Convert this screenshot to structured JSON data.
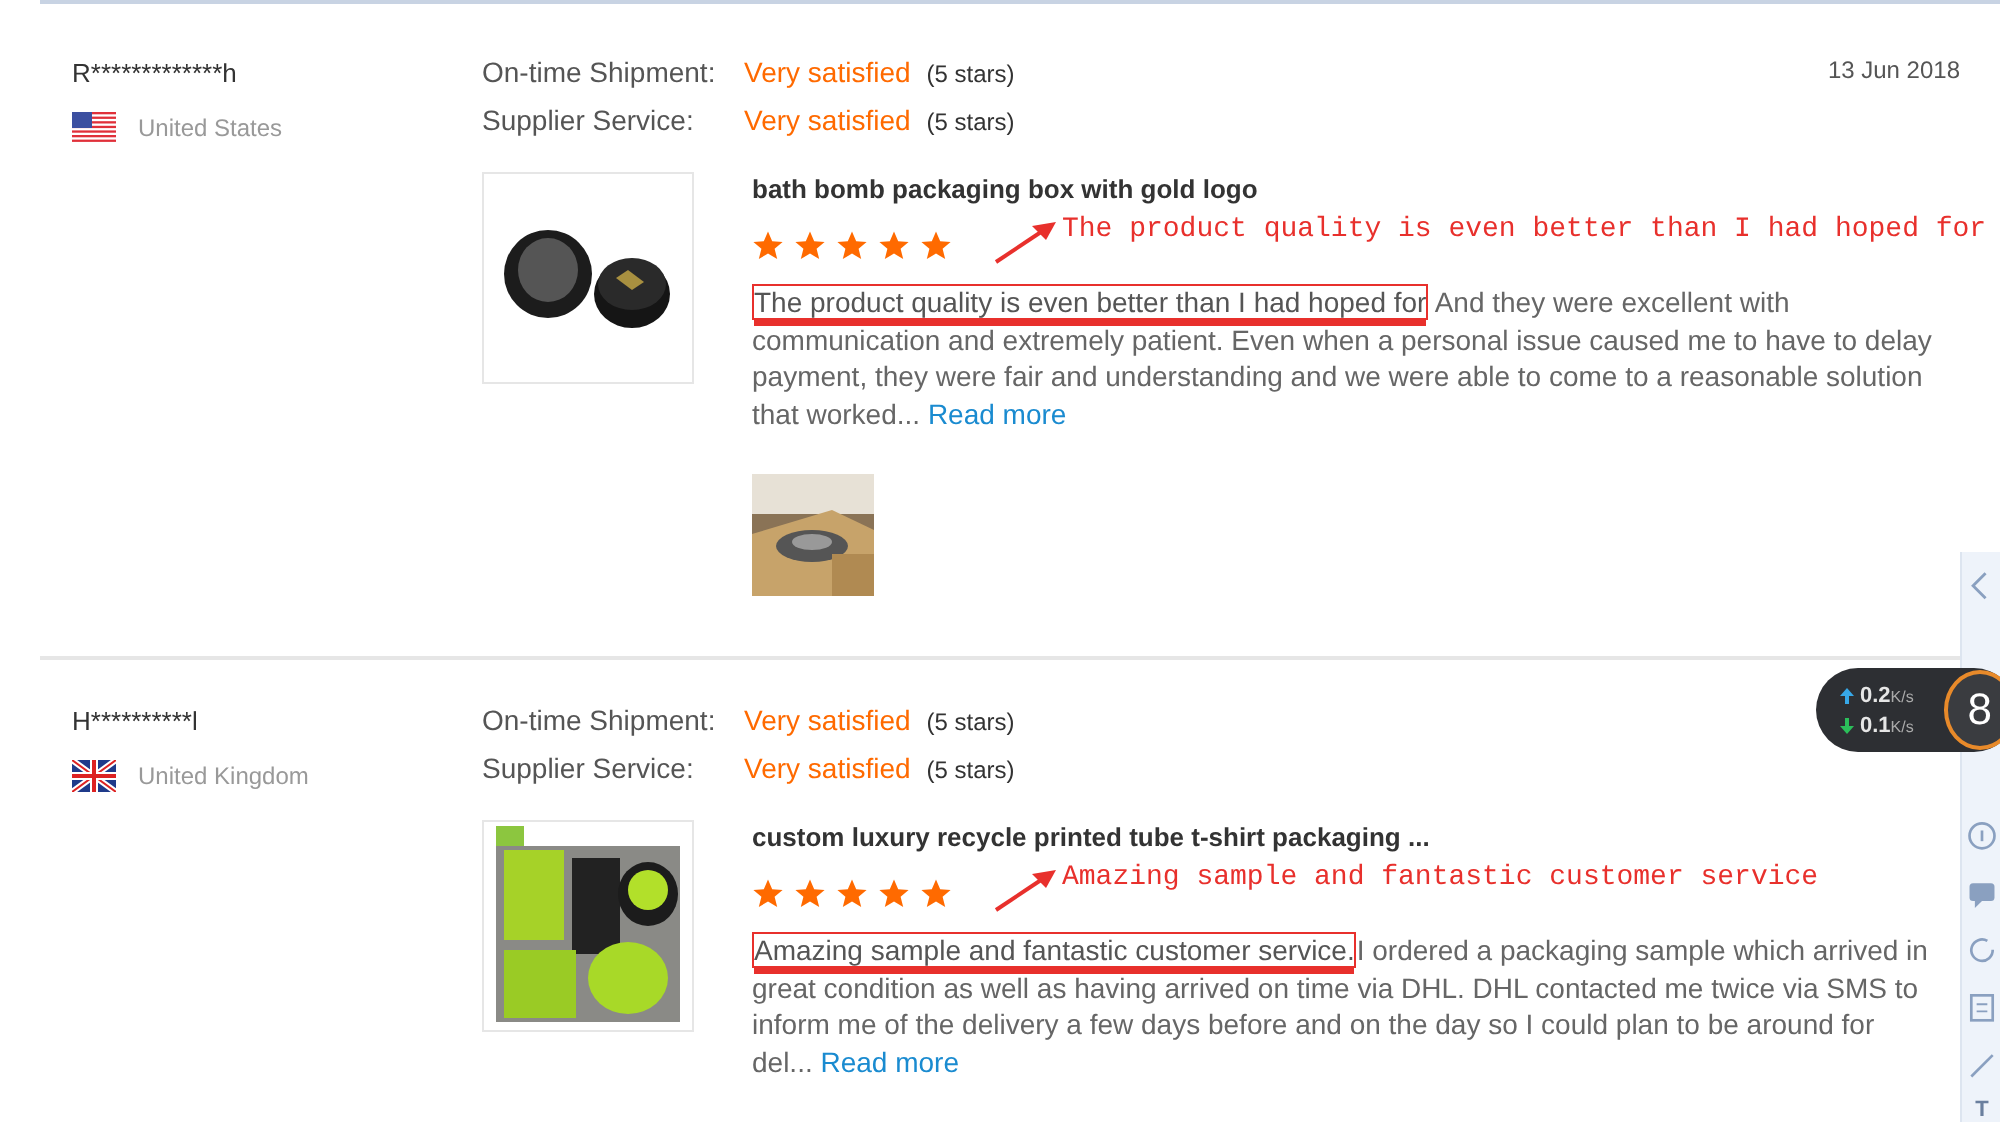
{
  "reviews": [
    {
      "name": "R*************h",
      "country": "United States",
      "date": "13 Jun 2018",
      "ratings": [
        {
          "label": "On-time Shipment:",
          "value": "Very satisfied",
          "stars_text": "(5 stars)"
        },
        {
          "label": "Supplier Service:",
          "value": "Very satisfied",
          "stars_text": "(5 stars)"
        }
      ],
      "product": {
        "title": "bath bomb packaging box with gold logo"
      },
      "stars": 5,
      "annotation": "The product quality is even better than I had hoped for",
      "highlight": "The product quality is even better than I had hoped for",
      "text": " And they were excellent with communication and extremely patient. Even when a personal issue caused me to have to delay payment, they were fair and understanding and we were able to come to a reasonable solution that worked...",
      "read_more": "Read more",
      "has_photo": true
    },
    {
      "name": "H**********l",
      "country": "United Kingdom",
      "ratings": [
        {
          "label": "On-time Shipment:",
          "value": "Very satisfied",
          "stars_text": "(5 stars)"
        },
        {
          "label": "Supplier Service:",
          "value": "Very satisfied",
          "stars_text": "(5 stars)"
        }
      ],
      "product": {
        "title": "custom luxury recycle printed tube t-shirt packaging ..."
      },
      "stars": 5,
      "annotation": "Amazing sample and fantastic customer service",
      "highlight": "Amazing sample and fantastic customer service.",
      "text": "I ordered a packaging sample which arrived in great condition as well as having arrived on time via DHL. DHL contacted me twice via SMS to inform me of the delivery a few days before and on the day so I could plan to be around for del...",
      "read_more": "Read more",
      "has_photo": false
    }
  ],
  "speed_widget": {
    "upload": "0.2",
    "upload_unit": "K/s",
    "download": "0.1",
    "download_unit": "K/s",
    "score": "8"
  },
  "side_toolbar": {
    "bottom_text": "T"
  }
}
